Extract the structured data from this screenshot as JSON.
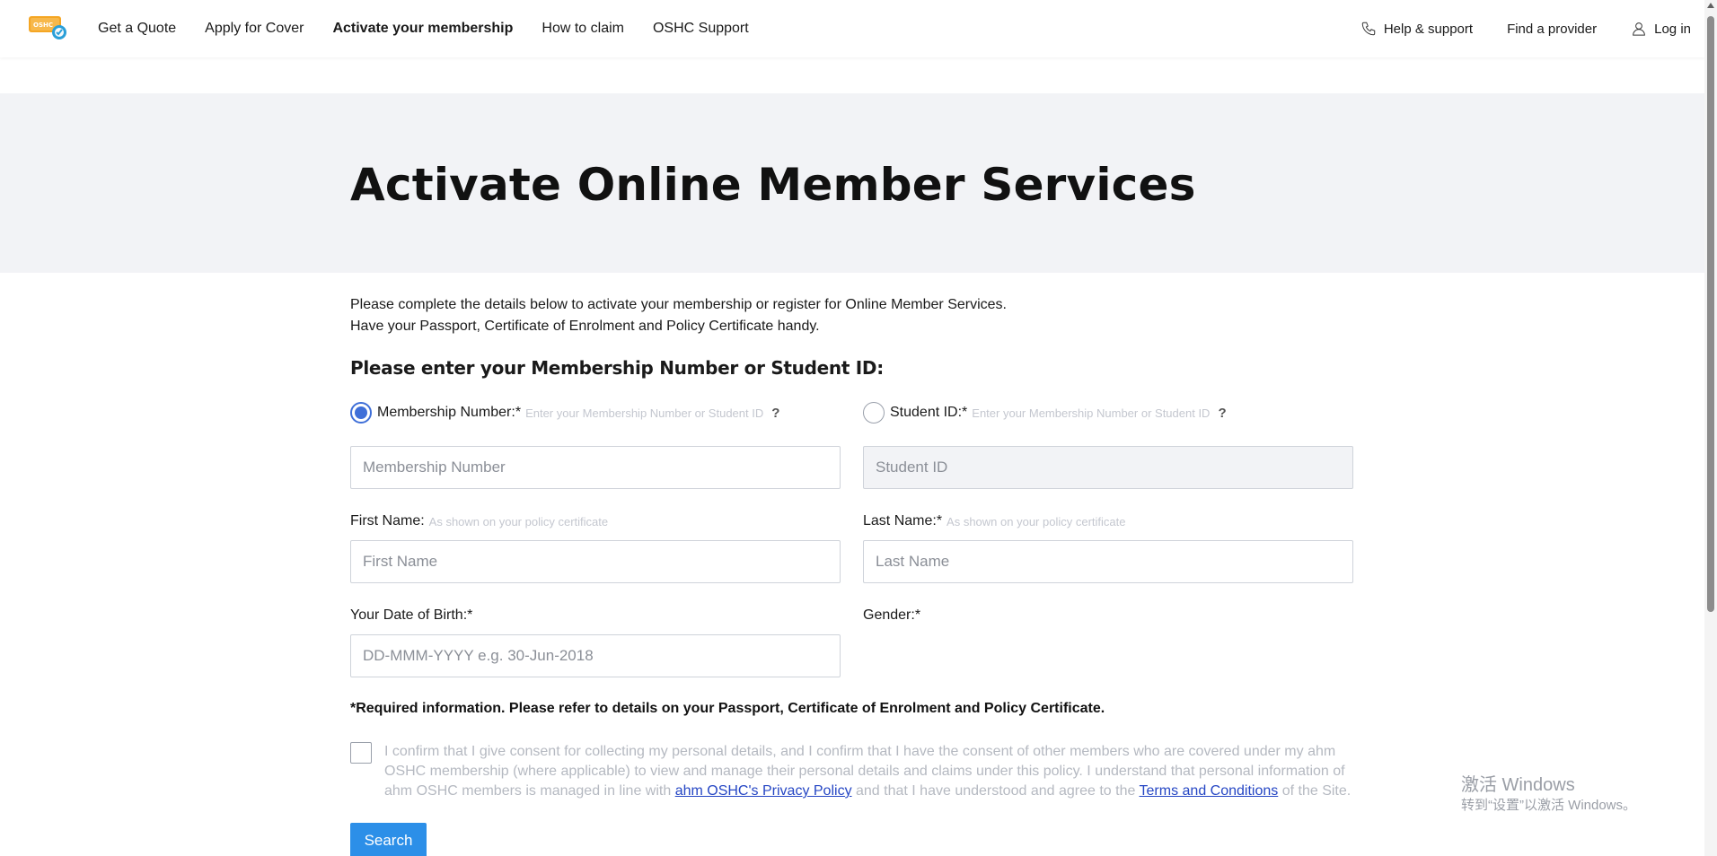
{
  "nav": {
    "logo_alt": "OSHC",
    "links": [
      {
        "label": "Get a Quote",
        "active": false
      },
      {
        "label": "Apply for Cover",
        "active": false
      },
      {
        "label": "Activate your membership",
        "active": true
      },
      {
        "label": "How to claim",
        "active": false
      },
      {
        "label": "OSHC Support",
        "active": false
      }
    ],
    "help_label": "Help & support",
    "provider_label": "Find a provider",
    "login_label": "Log in"
  },
  "hero": {
    "title": "Activate Online Member Services"
  },
  "intro": {
    "line1": "Please complete the details below to activate your membership or register for Online Member Services.",
    "line2": "Have your Passport, Certificate of Enrolment and Policy Certificate handy."
  },
  "form": {
    "section_title": "Please enter your Membership Number or Student ID:",
    "membership": {
      "label": "Membership Number:*",
      "hint": "Enter your Membership Number or Student ID",
      "help": "?",
      "placeholder": "Membership Number",
      "selected": true
    },
    "student": {
      "label": "Student ID:*",
      "hint": "Enter your Membership Number or Student ID",
      "help": "?",
      "placeholder": "Student ID",
      "selected": false
    },
    "first_name": {
      "label": "First Name:",
      "hint": "As shown on your policy certificate",
      "placeholder": "First Name"
    },
    "last_name": {
      "label": "Last Name:*",
      "hint": "As shown on your policy certificate",
      "placeholder": "Last Name"
    },
    "dob": {
      "label": "Your Date of Birth:*",
      "placeholder": "DD-MMM-YYYY e.g. 30-Jun-2018"
    },
    "gender": {
      "label": "Gender:*"
    },
    "required_note": "*Required information. Please refer to details on your Passport, Certificate of Enrolment and Policy Certificate.",
    "consent": {
      "text_before": "I confirm that I give consent for collecting my personal details, and I confirm that I have the consent of other members who are covered under my ahm OSHC membership (where applicable) to view and manage their personal details and claims under this policy. I understand that personal information of ahm OSHC members is managed in line with ",
      "privacy_link": "ahm OSHC's Privacy Policy",
      "text_middle": " and that I have understood and agree to the ",
      "terms_link": "Terms and Conditions",
      "text_after": " of the Site."
    },
    "search_label": "Search"
  },
  "watermark": {
    "line1": "激活 Windows",
    "line2": "转到“设置”以激活 Windows。"
  },
  "colors": {
    "accent": "#3f6fd8",
    "button": "#2c8fe8",
    "hero_bg": "#f2f3f6",
    "link": "#2546c4"
  }
}
